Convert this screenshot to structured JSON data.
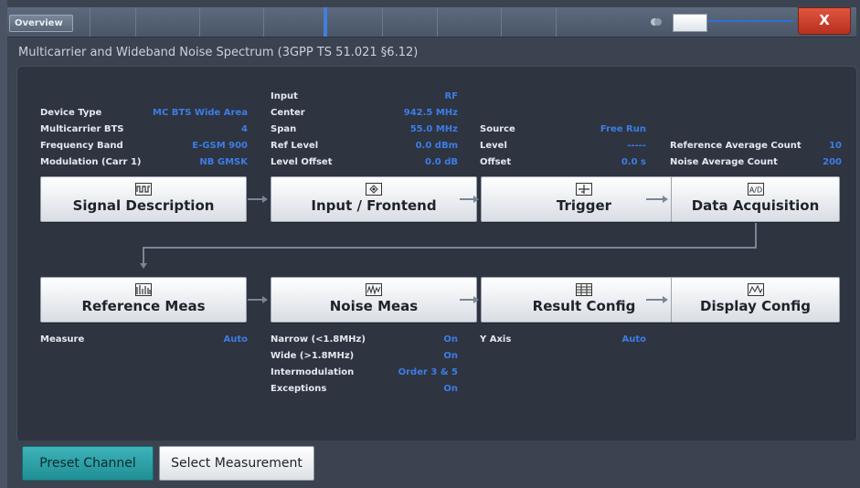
{
  "window": {
    "tab": "Overview",
    "close": "X"
  },
  "title": "Multicarrier and Wideband Noise Spectrum (3GPP TS 51.021 §6.12)",
  "signal_info": [
    {
      "label": "Device Type",
      "value": "MC BTS Wide Area"
    },
    {
      "label": "Multicarrier BTS",
      "value": "4"
    },
    {
      "label": "Frequency Band",
      "value": "E-GSM 900"
    },
    {
      "label": "Modulation (Carr 1)",
      "value": "NB GMSK"
    }
  ],
  "input_info": [
    {
      "label": "Input",
      "value": "RF"
    },
    {
      "label": "Center",
      "value": "942.5 MHz"
    },
    {
      "label": "Span",
      "value": "55.0 MHz"
    },
    {
      "label": "Ref Level",
      "value": "0.0 dBm"
    },
    {
      "label": "Level Offset",
      "value": "0.0 dB"
    }
  ],
  "trigger_info": [
    {
      "label": "Source",
      "value": "Free Run"
    },
    {
      "label": "Level",
      "value": "-----"
    },
    {
      "label": "Offset",
      "value": "0.0 s"
    }
  ],
  "acq_info": [
    {
      "label": "Reference Average Count",
      "value": "10"
    },
    {
      "label": "Noise Average Count",
      "value": "200"
    }
  ],
  "blocks": {
    "signal": {
      "label": "Signal Description",
      "icon": "signal-waveform-icon"
    },
    "input": {
      "label": "Input / Frontend",
      "icon": "frontend-icon"
    },
    "trigger": {
      "label": "Trigger",
      "icon": "trigger-icon"
    },
    "acq": {
      "label": "Data Acquisition",
      "icon": "ad-converter-icon"
    },
    "refmeas": {
      "label": "Reference Meas",
      "icon": "reference-meas-icon"
    },
    "noise": {
      "label": "Noise Meas",
      "icon": "noise-meas-icon"
    },
    "result": {
      "label": "Result Config",
      "icon": "table-icon"
    },
    "display": {
      "label": "Display Config",
      "icon": "display-icon"
    }
  },
  "ref_info": [
    {
      "label": "Measure",
      "value": "Auto"
    }
  ],
  "noise_info": [
    {
      "label": "Narrow (<1.8MHz)",
      "value": "On"
    },
    {
      "label": "Wide (>1.8MHz)",
      "value": "On"
    },
    {
      "label": "Intermodulation",
      "value": "Order 3 & 5"
    },
    {
      "label": "Exceptions",
      "value": "On"
    }
  ],
  "result_info": [
    {
      "label": "Y Axis",
      "value": "Auto"
    }
  ],
  "buttons": {
    "preset": "Preset Channel",
    "select": "Select Measurement"
  },
  "colors": {
    "value_blue": "#3d7de6",
    "preset_teal": "#2aa3a8",
    "close_red": "#c63a26"
  }
}
